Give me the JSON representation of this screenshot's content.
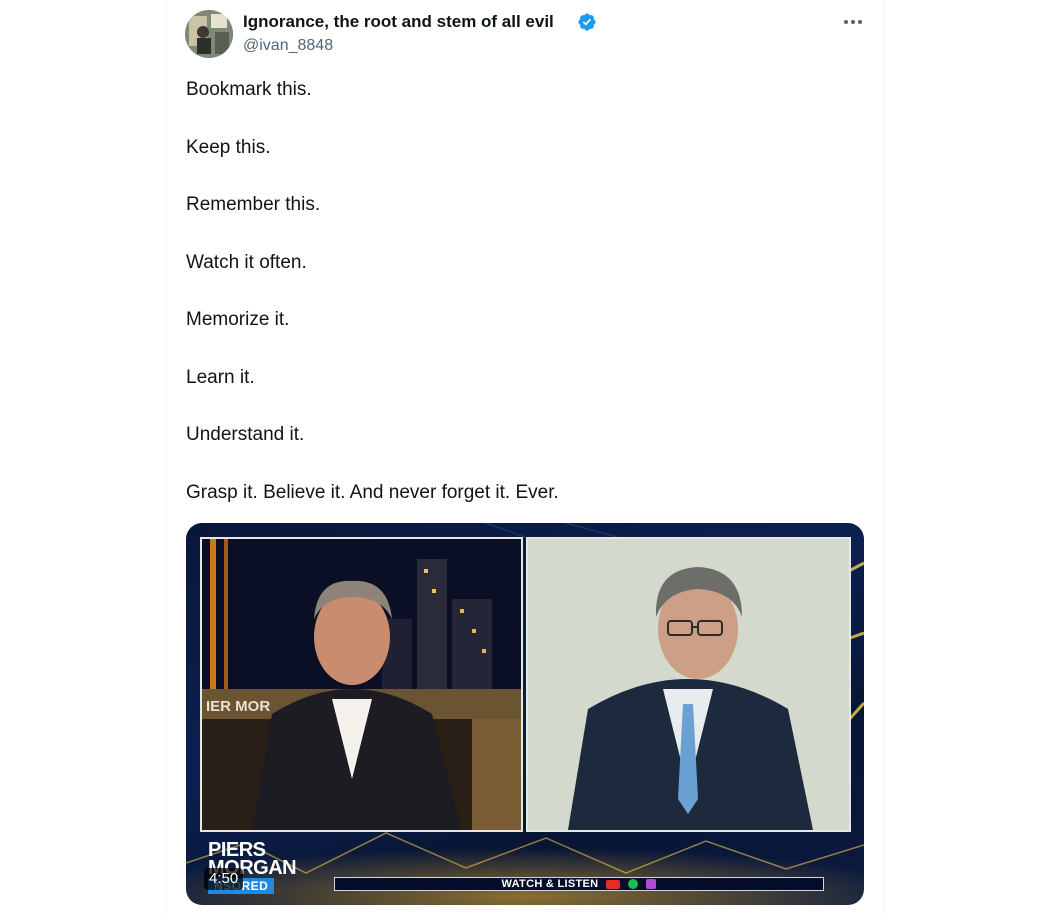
{
  "tweet": {
    "author": {
      "display_name": "Ignorance, the root and stem of all evil",
      "handle": "@ivan_8848",
      "verified": true,
      "verified_color": "#1d9bf0"
    },
    "more_icon": "more-horizontal-icon",
    "lines": [
      "Bookmark this.",
      "Keep this.",
      "Remember this.",
      "Watch it often.",
      "Memorize it.",
      "Learn it.",
      "Understand it.",
      "Grasp it. Believe it. And never forget it. Ever."
    ]
  },
  "video": {
    "duration": "4:50",
    "brand_line1": "PIERS",
    "brand_line2": "MORGAN",
    "brand_badge": "NSORED",
    "watch_label": "WATCH & LISTEN",
    "left_panel_sign": "IER MOR",
    "accent_color": "#1f8be0"
  }
}
